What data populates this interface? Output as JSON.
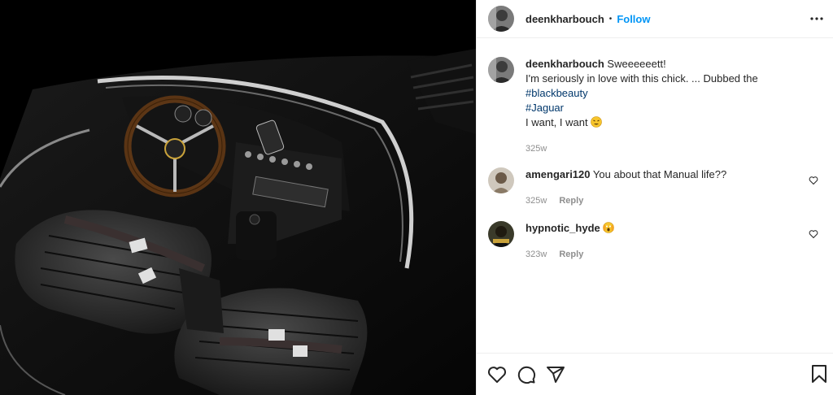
{
  "post": {
    "image_alt": "Jaguar E-Type interior top view",
    "author": "deenkharbouch",
    "separator": "•",
    "follow_label": "Follow"
  },
  "caption": {
    "username": "deenkharbouch",
    "line1": "Sweeeeeett!",
    "line2": "I'm seriously in love with this chick. ... Dubbed the",
    "hashtag1": "#blackbeauty",
    "hashtag2": "#Jaguar",
    "line3": "I want, I want",
    "time": "325w"
  },
  "comments": [
    {
      "username": "amengari120",
      "text": "You about that Manual life??",
      "time": "325w",
      "reply": "Reply"
    },
    {
      "username": "hypnotic_hyde",
      "text": "",
      "time": "323w",
      "reply": "Reply"
    }
  ],
  "icons": {
    "more": "more-options-icon",
    "like": "heart-icon",
    "comment": "comment-icon",
    "share": "paper-plane-icon",
    "save": "bookmark-icon"
  },
  "colors": {
    "link": "#0095f6",
    "hashtag": "#00376b",
    "muted": "#8e8e8e",
    "border": "#efefef"
  }
}
